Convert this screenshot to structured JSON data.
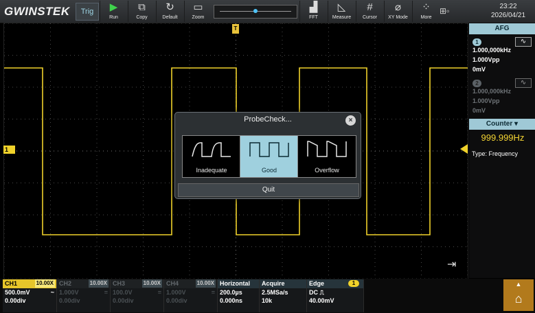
{
  "brand": "GWINSTEK",
  "top_bar": {
    "trig_label": "Trig",
    "buttons": [
      {
        "label": "Run",
        "icon": "play-icon"
      },
      {
        "label": "Copy",
        "icon": "copy-icon"
      },
      {
        "label": "Default",
        "icon": "refresh-icon"
      },
      {
        "label": "Zoom",
        "icon": "zoom-icon"
      },
      {
        "label": "FFT",
        "icon": "fft-icon"
      },
      {
        "label": "Measure",
        "icon": "measure-icon"
      },
      {
        "label": "Cursor",
        "icon": "cursor-icon"
      },
      {
        "label": "XY Mode",
        "icon": "xy-mode-icon"
      },
      {
        "label": "More",
        "icon": "more-icon"
      }
    ],
    "time": "23:22",
    "date": "2026/04/21"
  },
  "markers": {
    "trigger_position": "T",
    "channel1": "1"
  },
  "afg": {
    "header": "AFG",
    "ch1": {
      "num": "1",
      "freq": "1.000,000kHz",
      "amp": "1.000Vpp",
      "offset": "0mV"
    },
    "ch2": {
      "num": "2",
      "freq": "1.000,000kHz",
      "amp": "1.000Vpp",
      "offset": "0mV"
    },
    "wave_symbol": "∿"
  },
  "counter": {
    "header": "Counter",
    "value": "999.999Hz",
    "type": "Type: Frequency"
  },
  "dialog": {
    "title": "ProbeCheck...",
    "close_symbol": "×",
    "options": [
      "Inadequate",
      "Good",
      "Overflow"
    ],
    "selected": "Good",
    "quit_label": "Quit"
  },
  "bottom": {
    "ch1": {
      "name": "CH1",
      "probe": "10.00X",
      "scale": "500.0mV",
      "coupling": "~",
      "offset": "0.00div"
    },
    "ch2": {
      "name": "CH2",
      "probe": "10.00X",
      "scale": "1.000V",
      "coupling": "=",
      "offset": "0.00div"
    },
    "ch3": {
      "name": "CH3",
      "probe": "10.00X",
      "scale": "100.0V",
      "coupling": "=",
      "offset": "0.00div"
    },
    "ch4": {
      "name": "CH4",
      "probe": "10.00X",
      "scale": "1.000V",
      "coupling": "=",
      "offset": "0.00div"
    },
    "horizontal": {
      "name": "Horizontal",
      "line1": "200.0µs",
      "line2": "0.000ns"
    },
    "acquire": {
      "name": "Acquire",
      "line1": "2.5MSa/s",
      "line2": "10k"
    },
    "edge": {
      "name": "Edge",
      "badge": "1",
      "line1": "DC ⎍",
      "line2": "40.00mV"
    }
  },
  "colors": {
    "ch1": "#f0d22a",
    "accent": "#9fd0de",
    "home": "#b27a1c"
  }
}
